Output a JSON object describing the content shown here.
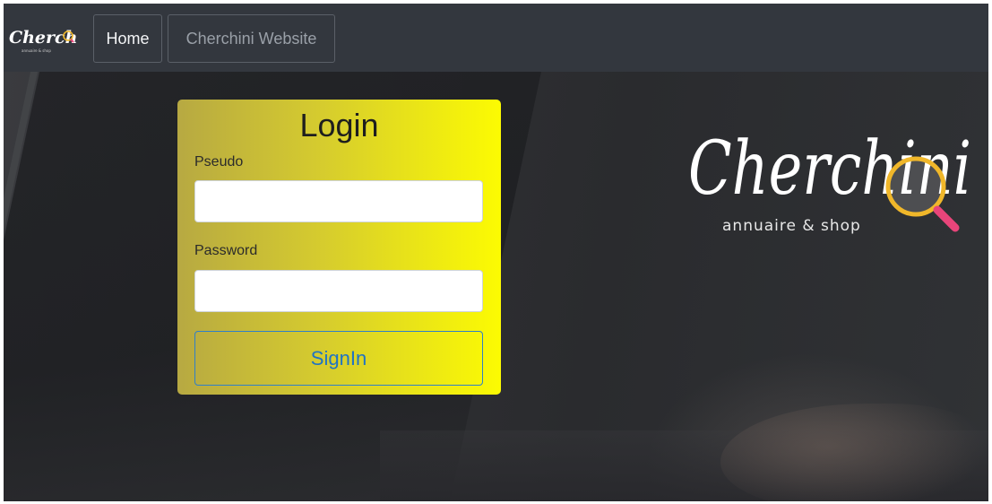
{
  "navbar": {
    "brand_text": "Cherchini",
    "brand_subtext": "annuaire & shop",
    "home_label": "Home",
    "website_label": "Cherchini Website"
  },
  "login": {
    "title": "Login",
    "pseudo_label": "Pseudo",
    "pseudo_value": "",
    "password_label": "Password",
    "password_value": "",
    "signin_label": "SignIn"
  },
  "logo": {
    "name": "Cherchini",
    "tagline": "annuaire & shop",
    "icon": "magnifier-icon"
  },
  "colors": {
    "navbar": "#33373e",
    "card_gradient_start": "#b7a942",
    "card_gradient_end": "#fcfb02",
    "signin_border": "#2f7fc9",
    "logo_ring": "#f0b72a",
    "logo_handle": "#e8457a"
  }
}
